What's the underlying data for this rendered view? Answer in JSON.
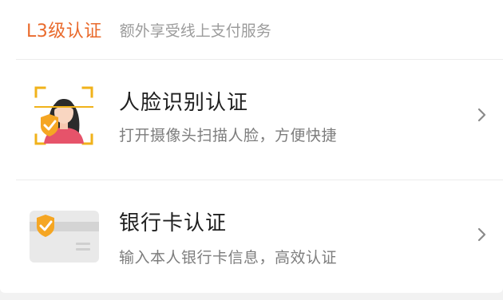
{
  "header": {
    "level_title": "L3级认证",
    "level_desc": "额外享受线上支付服务"
  },
  "items": [
    {
      "title": "人脸识别认证",
      "desc": "打开摄像头扫描人脸，方便快捷",
      "icon": "face-scan-icon"
    },
    {
      "title": "银行卡认证",
      "desc": "输入本人银行卡信息，高效认证",
      "icon": "bank-card-icon"
    }
  ],
  "colors": {
    "accent": "#e96a2c",
    "shield": "#f5a623",
    "scan_corner": "#f0b21a",
    "title_text": "#1f1f1f",
    "desc_text": "#7d7d7d",
    "divider": "#ececec"
  }
}
